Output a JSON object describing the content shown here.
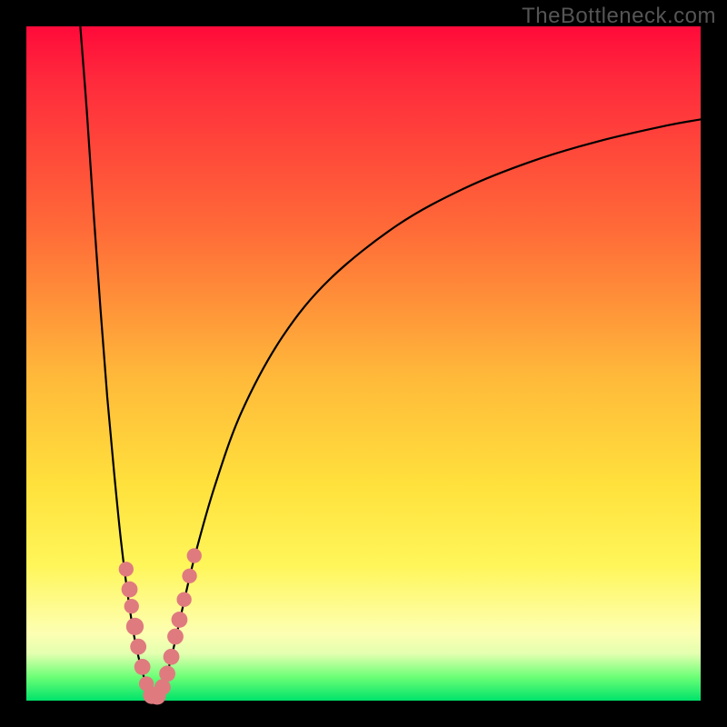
{
  "watermark": "TheBottleneck.com",
  "colors": {
    "frame": "#000000",
    "gradient_top": "#ff0a3a",
    "gradient_mid": "#ffe13c",
    "gradient_bottom": "#00e36a",
    "curve": "#000000",
    "marker": "#df7b7f"
  },
  "chart_data": {
    "type": "line",
    "title": "",
    "xlabel": "",
    "ylabel": "",
    "xlim": [
      0,
      100
    ],
    "ylim": [
      0,
      100
    ],
    "note": "x and y are in percent of the inner plot area (0,0 = top-left). Two visually distinct branches of a V-shaped curve with a minimum near x≈18–20%. Marker dots cluster near the bottom on both branches.",
    "series": [
      {
        "name": "left-branch",
        "x": [
          8.0,
          9.0,
          10.0,
          11.0,
          12.0,
          13.0,
          14.0,
          15.0,
          16.0,
          17.0,
          18.0,
          18.5
        ],
        "y": [
          0.0,
          13.0,
          28.0,
          42.0,
          55.0,
          66.0,
          76.0,
          84.0,
          90.5,
          95.0,
          98.2,
          99.5
        ]
      },
      {
        "name": "right-branch",
        "x": [
          19.5,
          20.0,
          21.0,
          22.0,
          23.0,
          25.0,
          28.0,
          32.0,
          38.0,
          45.0,
          55.0,
          65.0,
          75.0,
          85.0,
          95.0,
          100.0
        ],
        "y": [
          99.5,
          98.5,
          95.5,
          91.5,
          87.0,
          78.5,
          68.0,
          57.0,
          46.0,
          37.5,
          29.5,
          24.0,
          20.0,
          17.0,
          14.7,
          13.8
        ]
      }
    ],
    "markers": [
      {
        "x": 14.8,
        "y": 80.5,
        "r": 1.1
      },
      {
        "x": 15.3,
        "y": 83.5,
        "r": 1.2
      },
      {
        "x": 15.6,
        "y": 86.0,
        "r": 1.1
      },
      {
        "x": 16.1,
        "y": 89.0,
        "r": 1.3
      },
      {
        "x": 16.6,
        "y": 92.0,
        "r": 1.2
      },
      {
        "x": 17.2,
        "y": 95.0,
        "r": 1.2
      },
      {
        "x": 17.8,
        "y": 97.5,
        "r": 1.1
      },
      {
        "x": 18.6,
        "y": 99.2,
        "r": 1.3
      },
      {
        "x": 19.4,
        "y": 99.3,
        "r": 1.3
      },
      {
        "x": 20.2,
        "y": 98.0,
        "r": 1.2
      },
      {
        "x": 20.9,
        "y": 96.0,
        "r": 1.2
      },
      {
        "x": 21.5,
        "y": 93.5,
        "r": 1.2
      },
      {
        "x": 22.1,
        "y": 90.5,
        "r": 1.2
      },
      {
        "x": 22.7,
        "y": 88.0,
        "r": 1.2
      },
      {
        "x": 23.4,
        "y": 85.0,
        "r": 1.1
      },
      {
        "x": 24.2,
        "y": 81.5,
        "r": 1.1
      },
      {
        "x": 24.9,
        "y": 78.5,
        "r": 1.1
      }
    ]
  }
}
